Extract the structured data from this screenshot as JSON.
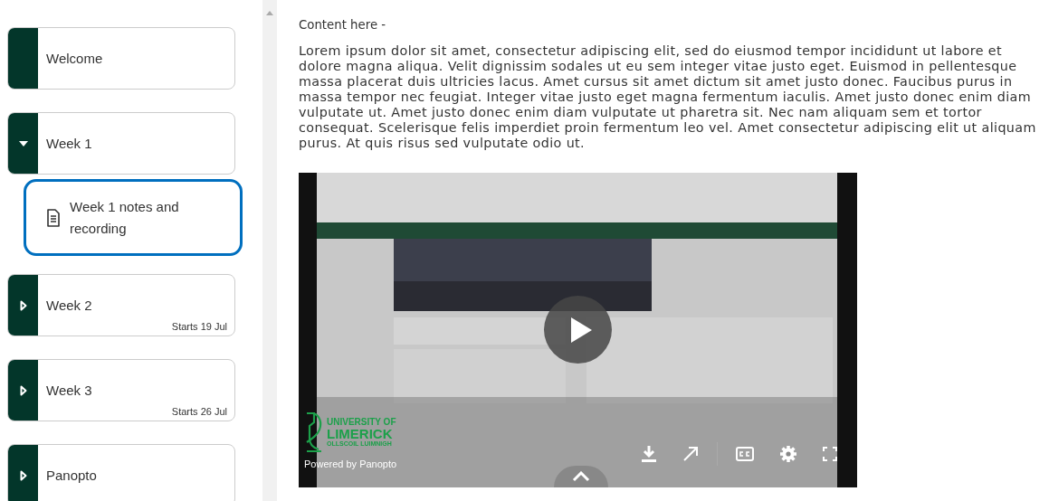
{
  "modules": [
    {
      "kind": "page",
      "title": "Welcome"
    },
    {
      "kind": "unit",
      "title": "Week 1",
      "expanded": true,
      "children": [
        {
          "title": "Week 1 notes and recording",
          "selected": true
        }
      ]
    },
    {
      "kind": "unit",
      "title": "Week 2",
      "expanded": false,
      "starts": "Starts 19 Jul"
    },
    {
      "kind": "unit",
      "title": "Week 3",
      "expanded": false,
      "starts": "Starts 26 Jul"
    },
    {
      "kind": "unit",
      "title": "Panopto",
      "expanded": false
    }
  ],
  "content": {
    "heading": "Content here -",
    "paragraph": "Lorem ipsum dolor sit amet, consectetur adipiscing elit, sed do eiusmod tempor incididunt ut labore et dolore magna aliqua. Velit dignissim sodales ut eu sem integer vitae justo eget. Euismod in pellentesque massa placerat duis ultricies lacus. Amet cursus sit amet dictum sit amet justo donec. Faucibus purus in massa tempor nec feugiat. Integer vitae justo eget magna fermentum iaculis. Amet justo donec enim diam vulputate ut. Amet justo donec enim diam vulputate ut pharetra sit. Nec nam aliquam sem et tortor consequat. Scelerisque felis imperdiet proin fermentum leo vel. Amet consectetur adipiscing elit ut aliquam purus. At quis risus sed vulputate odio ut."
  },
  "video": {
    "logo_lines": [
      "UNIVERSITY OF",
      "LIMERICK",
      "OLLSCOIL LUIMNIGH"
    ],
    "powered_by": "Powered by Panopto"
  }
}
